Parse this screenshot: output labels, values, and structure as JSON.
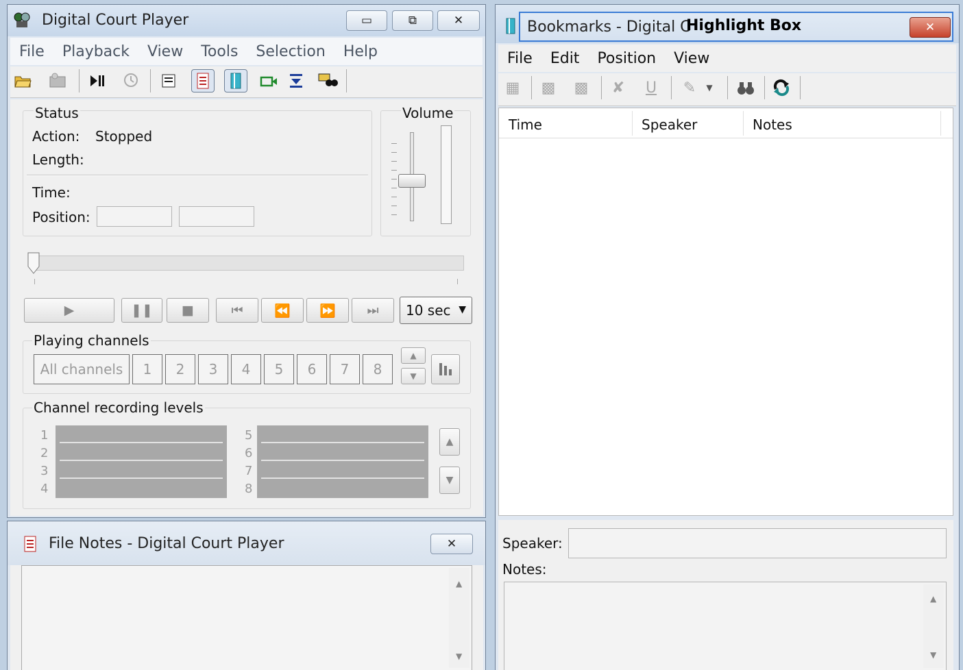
{
  "player": {
    "title": "Digital Court Player",
    "menu": [
      "File",
      "Playback",
      "View",
      "Tools",
      "Selection",
      "Help"
    ],
    "status": {
      "group_label": "Status",
      "action_label": "Action:",
      "action_value": "Stopped",
      "length_label": "Length:",
      "time_label": "Time:",
      "position_label": "Position:"
    },
    "volume": {
      "label": "Volume",
      "level": 0.45
    },
    "seek": {
      "position": 0.0
    },
    "jump_interval": "10 sec",
    "channels": {
      "label": "Playing channels",
      "all": "All channels",
      "numbers": [
        "1",
        "2",
        "3",
        "4",
        "5",
        "6",
        "7",
        "8"
      ]
    },
    "levels": {
      "label": "Channel recording levels",
      "left_numbers": [
        "1",
        "2",
        "3",
        "4"
      ],
      "right_numbers": [
        "5",
        "6",
        "7",
        "8"
      ]
    }
  },
  "file_notes": {
    "title": "File Notes - Digital Court Player"
  },
  "bookmarks": {
    "title": "Bookmarks - Digital C",
    "title_overlay": "Highlight Box",
    "menu": [
      "File",
      "Edit",
      "Position",
      "View"
    ],
    "columns": [
      "Time",
      "Speaker",
      "Notes"
    ],
    "speaker_label": "Speaker:",
    "notes_label": "Notes:"
  },
  "colors": {
    "title_active": "#c7d7ea",
    "close_red": "#c6422b",
    "meter_gray": "#a8a8a8"
  }
}
